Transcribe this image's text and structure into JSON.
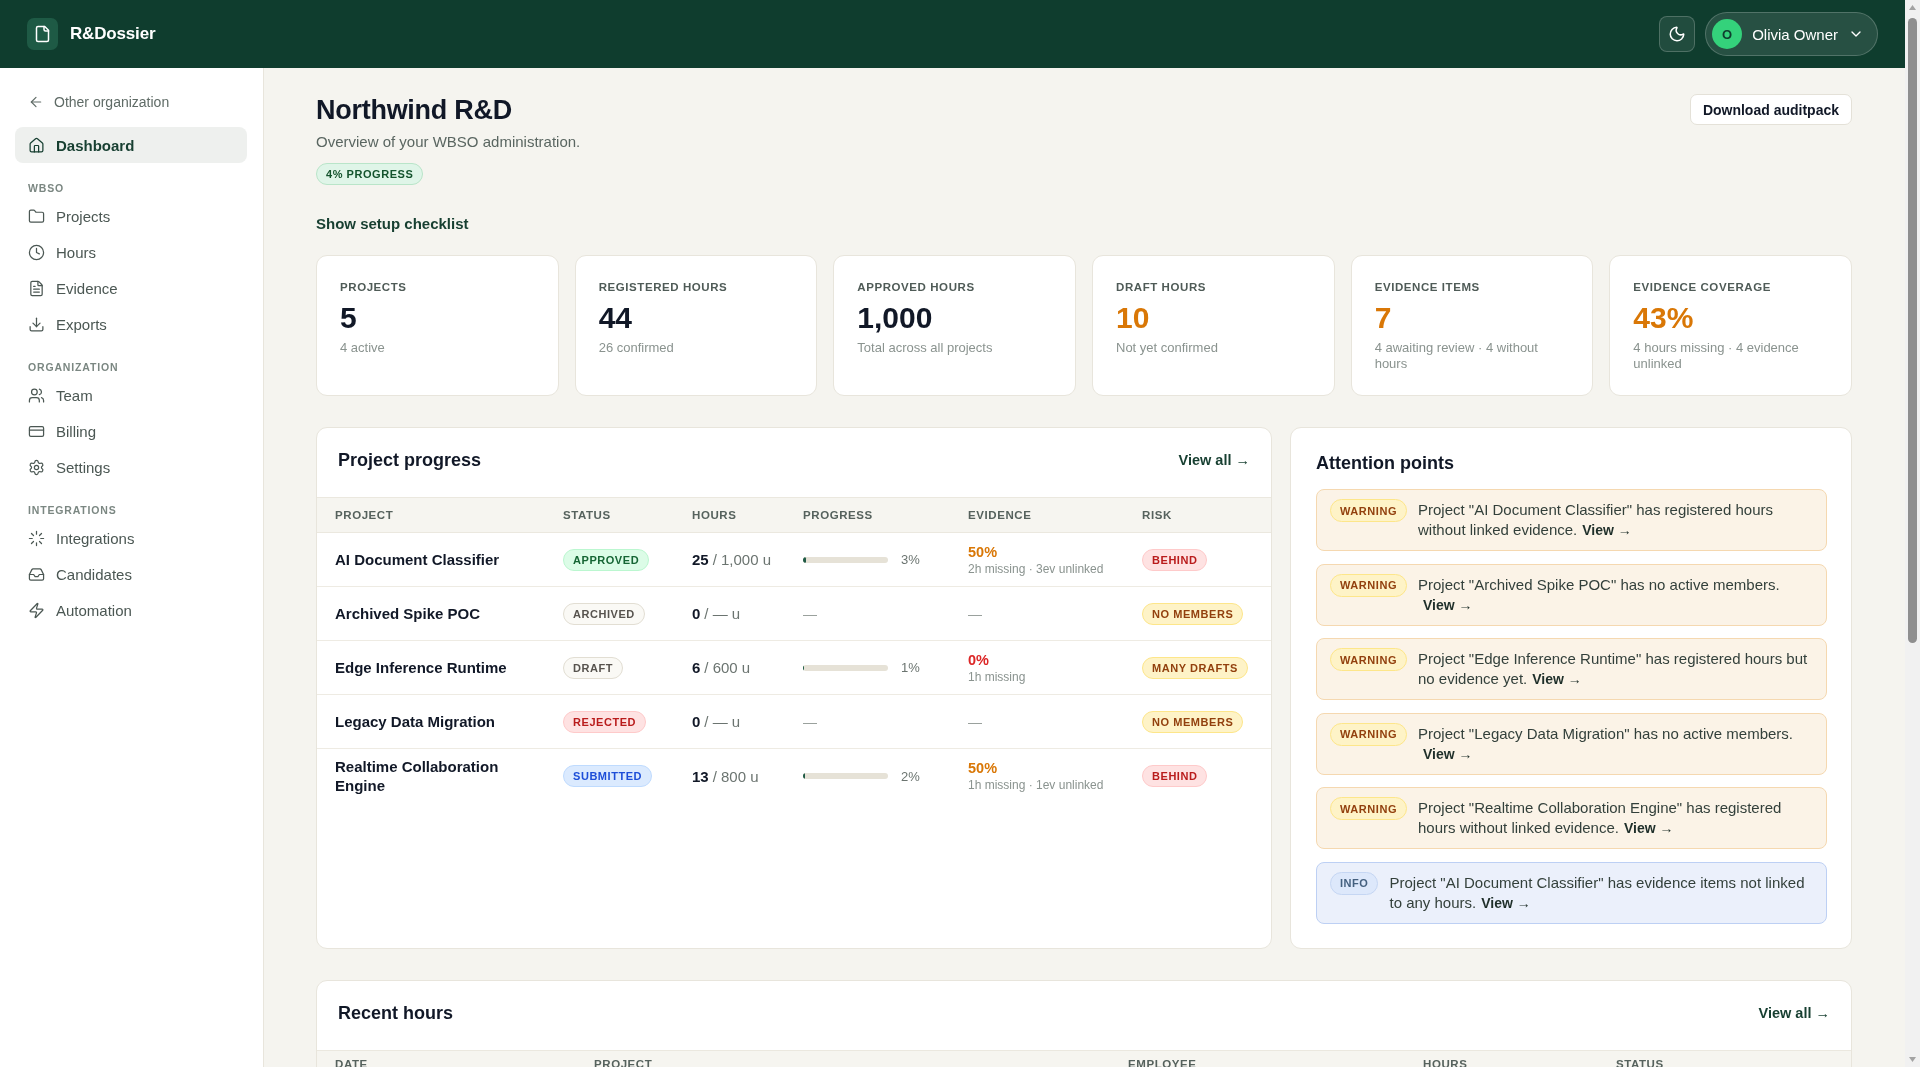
{
  "top_bar": {
    "brand": "R&Dossier",
    "user": {
      "initial": "O",
      "name": "Olivia Owner"
    }
  },
  "sidebar": {
    "back_link": "Other organization",
    "groups": [
      {
        "items": [
          {
            "label": "Dashboard",
            "selected": true
          }
        ]
      },
      {
        "title": "WBSO",
        "items": [
          {
            "label": "Projects",
            "selected": false
          },
          {
            "label": "Hours",
            "selected": false
          },
          {
            "label": "Evidence",
            "selected": false
          },
          {
            "label": "Exports",
            "selected": false
          }
        ]
      },
      {
        "title": "ORGANIZATION",
        "items": [
          {
            "label": "Team",
            "selected": false
          },
          {
            "label": "Billing",
            "selected": false
          },
          {
            "label": "Settings",
            "selected": false
          }
        ]
      },
      {
        "title": "INTEGRATIONS",
        "items": [
          {
            "label": "Integrations",
            "selected": false
          },
          {
            "label": "Candidates",
            "selected": false
          },
          {
            "label": "Automation",
            "selected": false
          }
        ]
      }
    ]
  },
  "header": {
    "title": "Northwind R&D",
    "subtitle": "Overview of your WBSO administration.",
    "progress_badge": "4% PROGRESS",
    "checklist_link": "Show setup checklist",
    "download_button": "Download auditpack"
  },
  "stats": [
    {
      "label": "PROJECTS",
      "value": "5",
      "note": "4 active",
      "color": "#111827"
    },
    {
      "label": "REGISTERED HOURS",
      "value": "44",
      "note": "26 confirmed",
      "color": "#111827"
    },
    {
      "label": "APPROVED HOURS",
      "value": "1,000",
      "note": "Total across all projects",
      "color": "#111827"
    },
    {
      "label": "DRAFT HOURS",
      "value": "10",
      "note": "Not yet confirmed",
      "color": "#d97706"
    },
    {
      "label": "EVIDENCE ITEMS",
      "value": "7",
      "note": "4 awaiting review · 4 without hours",
      "color": "#d97706"
    },
    {
      "label": "EVIDENCE COVERAGE",
      "value": "43%",
      "note": "4 hours missing · 4 evidence unlinked",
      "color": "#d97706"
    }
  ],
  "project_progress": {
    "title": "Project progress",
    "view_all": "View all →",
    "columns": [
      "PROJECT",
      "STATUS",
      "HOURS",
      "PROGRESS",
      "EVIDENCE",
      "RISK"
    ],
    "rows": [
      {
        "name": "AI Document Classifier",
        "status": {
          "label": "APPROVED",
          "kind": "approved"
        },
        "hours": "25",
        "budget": "/ 1,000 u",
        "progress": {
          "kind": "bar",
          "level": 0.03,
          "reading": "3%"
        },
        "evidence": {
          "kind": "coverage",
          "percent": "50%",
          "color": "#d97706",
          "detail": "2h missing · 3ev unlinked"
        },
        "risk": {
          "label": "BEHIND",
          "kind": "danger"
        }
      },
      {
        "name": "Archived Spike POC",
        "status": {
          "label": "ARCHIVED",
          "kind": "neutral"
        },
        "hours": "0",
        "budget": "/ — u",
        "progress": {
          "kind": "empty",
          "text": "—"
        },
        "evidence": {
          "kind": "empty",
          "text": "—"
        },
        "risk": {
          "label": "NO MEMBERS",
          "kind": "warning"
        }
      },
      {
        "name": "Edge Inference Runtime",
        "status": {
          "label": "DRAFT",
          "kind": "neutral"
        },
        "hours": "6",
        "budget": "/ 600 u",
        "progress": {
          "kind": "bar",
          "level": 0.01,
          "reading": "1%"
        },
        "evidence": {
          "kind": "coverage",
          "percent": "0%",
          "color": "#dc2626",
          "detail": "1h missing"
        },
        "risk": {
          "label": "MANY DRAFTS",
          "kind": "warning"
        }
      },
      {
        "name": "Legacy Data Migration",
        "status": {
          "label": "REJECTED",
          "kind": "rejected"
        },
        "hours": "0",
        "budget": "/ — u",
        "progress": {
          "kind": "empty",
          "text": "—"
        },
        "evidence": {
          "kind": "empty",
          "text": "—"
        },
        "risk": {
          "label": "NO MEMBERS",
          "kind": "warning"
        }
      },
      {
        "name": "Realtime Collaboration Engine",
        "status": {
          "label": "SUBMITTED",
          "kind": "submitted"
        },
        "hours": "13",
        "budget": "/ 800 u",
        "progress": {
          "kind": "bar",
          "level": 0.02,
          "reading": "2%"
        },
        "evidence": {
          "kind": "coverage",
          "percent": "50%",
          "color": "#d97706",
          "detail": "1h missing · 1ev unlinked"
        },
        "risk": {
          "label": "BEHIND",
          "kind": "danger"
        }
      }
    ]
  },
  "attention": {
    "title": "Attention points",
    "items": [
      {
        "kind": "warning",
        "badge": "WARNING",
        "message": "Project \"AI Document Classifier\" has registered hours without linked evidence.",
        "link": "View →"
      },
      {
        "kind": "warning",
        "badge": "WARNING",
        "message": "Project \"Archived Spike POC\" has no active members.",
        "link": "View →"
      },
      {
        "kind": "warning",
        "badge": "WARNING",
        "message": "Project \"Edge Inference Runtime\" has registered hours but no evidence yet.",
        "link": "View →"
      },
      {
        "kind": "warning",
        "badge": "WARNING",
        "message": "Project \"Legacy Data Migration\" has no active members.",
        "link": "View →"
      },
      {
        "kind": "warning",
        "badge": "WARNING",
        "message": "Project \"Realtime Collaboration Engine\" has registered hours without linked evidence.",
        "link": "View →"
      },
      {
        "kind": "info",
        "badge": "INFO",
        "message": "Project \"AI Document Classifier\" has evidence items not linked to any hours.",
        "link": "View →"
      }
    ]
  },
  "recent_hours": {
    "title": "Recent hours",
    "view_all": "View all →",
    "columns": [
      "DATE",
      "PROJECT",
      "EMPLOYEE",
      "HOURS",
      "STATUS"
    ]
  }
}
